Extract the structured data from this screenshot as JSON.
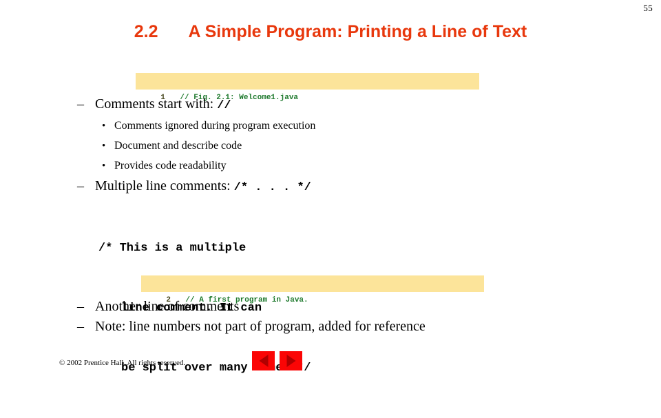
{
  "slide": {
    "page_number": "55",
    "title_number": "2.2",
    "title_text": "A Simple Program: Printing a Line of Text",
    "title_color": "#e8380d"
  },
  "code_strips": [
    {
      "line_number": "1",
      "code": "// Fig. 2.1: Welcome1.java",
      "bg_color": "#fce49a",
      "text_color": "#1f7a2e"
    },
    {
      "line_number": "2",
      "code": "// A first program in Java.",
      "bg_color": "#fce49a",
      "text_color": "#1f7a2e"
    }
  ],
  "bullets": {
    "comments_start": {
      "marker": "–",
      "prose": "Comments start with: ",
      "code": "//"
    },
    "sub_items": [
      {
        "marker": "•",
        "text": "Comments ignored during program execution"
      },
      {
        "marker": "•",
        "text": "Document and describe code"
      },
      {
        "marker": "•",
        "text": "Provides code readability"
      }
    ],
    "multiline": {
      "marker": "–",
      "prose": "Multiple line comments: ",
      "code": "/*  . . .  */"
    },
    "another_line": {
      "marker": "–",
      "text": "Another line of comments"
    },
    "note_line": {
      "marker": "–",
      "text": "Note: line numbers not part of program, added for reference"
    }
  },
  "comment_block": {
    "line1": "/* This is a multiple",
    "line2": "line comment. It can",
    "line3": "be split over many lines */"
  },
  "footer": {
    "copyright": "© 2002 Prentice Hall.  All rights reserved.",
    "prev_label": "Previous slide",
    "next_label": "Next slide",
    "button_color": "#fb0505",
    "arrow_color": "#b00000"
  }
}
